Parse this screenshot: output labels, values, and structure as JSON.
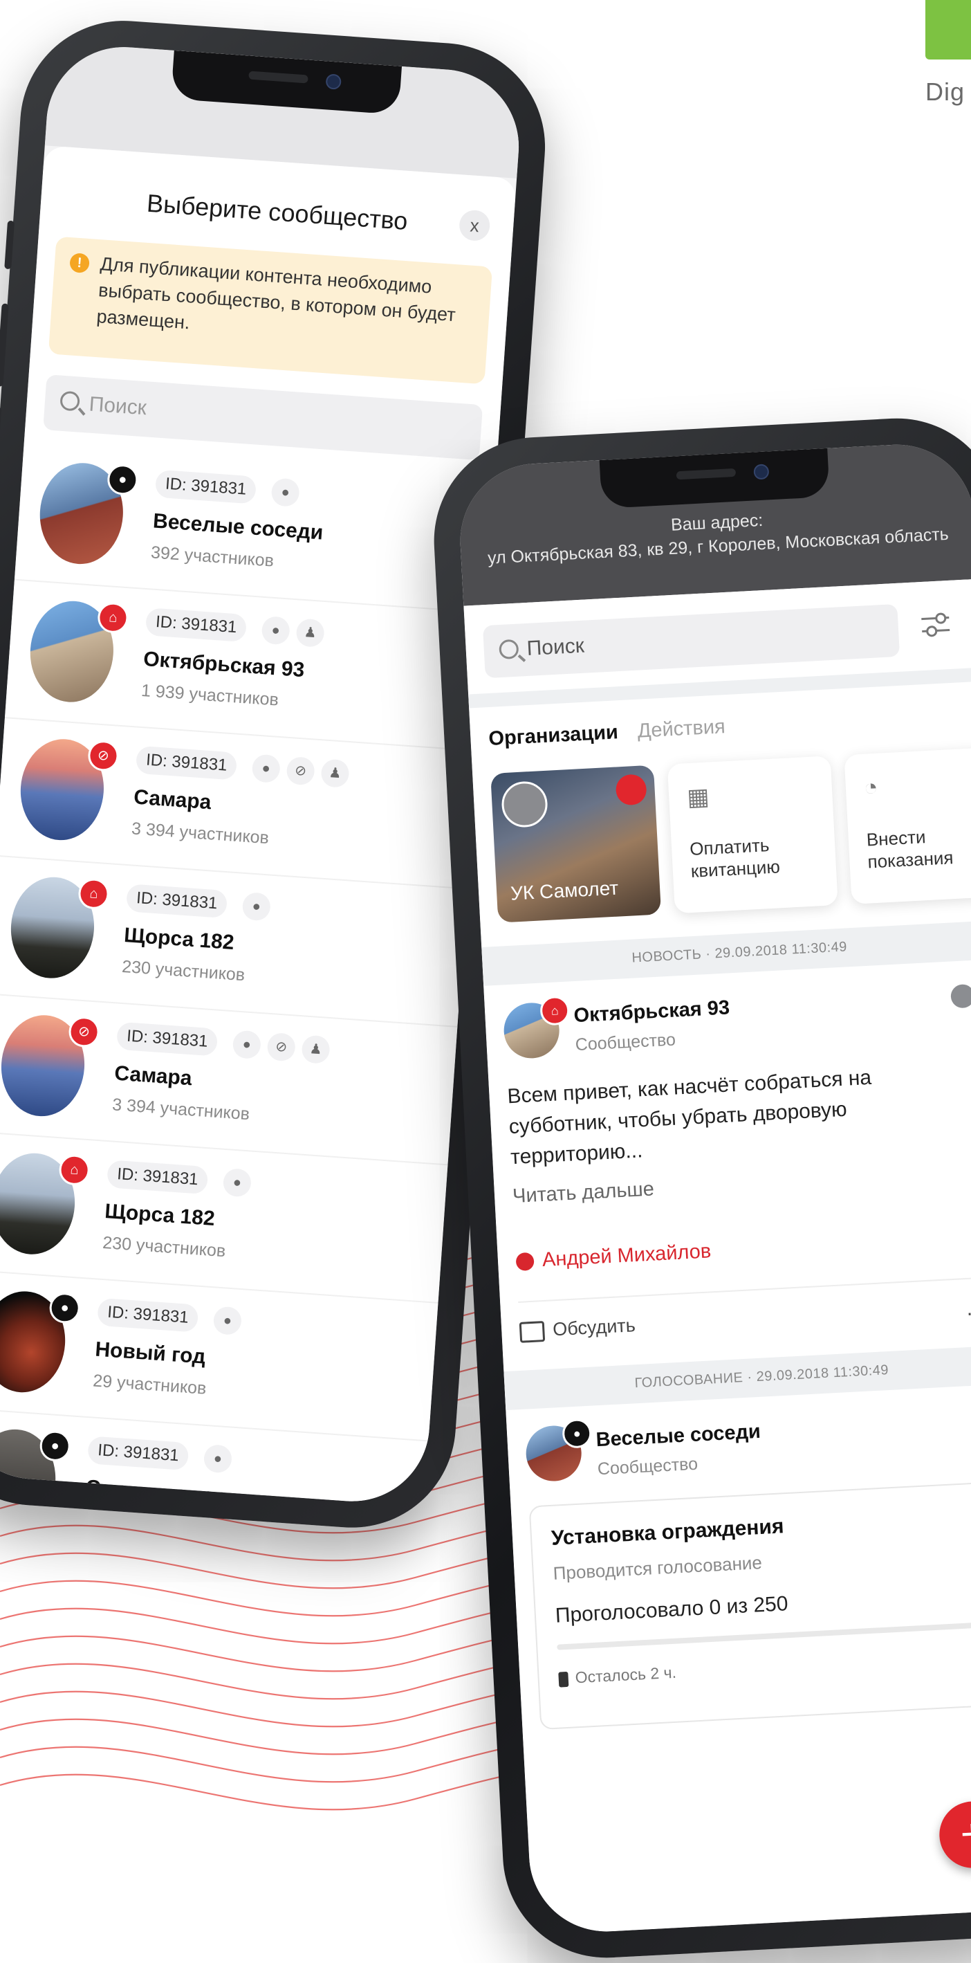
{
  "brand": {
    "text": "Dig",
    "accent_color": "#7dc242"
  },
  "community_picker": {
    "title": "Выберите сообщество",
    "close_icon_label": "x",
    "warning_icon": "exclamation-icon",
    "warning_text": "Для публикации контента необходимо выбрать сообщество, в котором он будет размещен.",
    "search_placeholder": "Поиск",
    "communities": [
      {
        "id": "ID: 391831",
        "name": "Веселые соседи",
        "members": "392 участников",
        "badge": "black"
      },
      {
        "id": "ID: 391831",
        "name": "Октябрьская 93",
        "members": "1 939 участников",
        "badge": "red"
      },
      {
        "id": "ID: 391831",
        "name": "Самара",
        "members": "3 394 участников",
        "badge": "red"
      },
      {
        "id": "ID: 391831",
        "name": "Щорса 182",
        "members": "230 участников",
        "badge": "red"
      },
      {
        "id": "ID: 391831",
        "name": "Самара",
        "members": "3 394 участников",
        "badge": "red"
      },
      {
        "id": "ID: 391831",
        "name": "Щорса 182",
        "members": "230 участников",
        "badge": "red"
      },
      {
        "id": "ID: 391831",
        "name": "Новый год",
        "members": "29 участников",
        "badge": "black"
      },
      {
        "id": "ID: 391831",
        "name": "Смешные картинки",
        "members": "",
        "badge": "black"
      }
    ]
  },
  "feed": {
    "address_label": "Ваш адрес:",
    "address": "ул Октябрьская 83, кв 29, г Королев, Московская область",
    "search_placeholder": "Поиск",
    "tabs": {
      "active": "Организации",
      "inactive": "Действия"
    },
    "org_card_label": "УК Самолет",
    "actions": [
      {
        "label": "Оплатить квитанцию",
        "icon": "receipt-icon"
      },
      {
        "label": "Внести показания",
        "icon": "meter-icon"
      }
    ],
    "news_strip": "НОВОСТЬ · 29.09.2018 11:30:49",
    "news_post": {
      "community": "Октябрьская 93",
      "type": "Сообщество",
      "text": "Всем привет, как насчёт собраться на субботник, чтобы убрать дворовую территорию...",
      "read_more": "Читать дальше",
      "author": "Андрей Михайлов",
      "discuss": "Обсудить",
      "more": "..."
    },
    "vote_strip": "ГОЛОСОВАНИЕ · 29.09.2018 11:30:49",
    "vote_post": {
      "community": "Веселые соседи",
      "type": "Сообщество",
      "poll_title": "Установка ограждения",
      "poll_status": "Проводится голосование",
      "poll_count": "Проголосовало 0 из 250",
      "poll_progress": 0,
      "remaining": "Осталось 2 ч."
    },
    "fab_label": "+",
    "accent_color": "#e1262d"
  }
}
